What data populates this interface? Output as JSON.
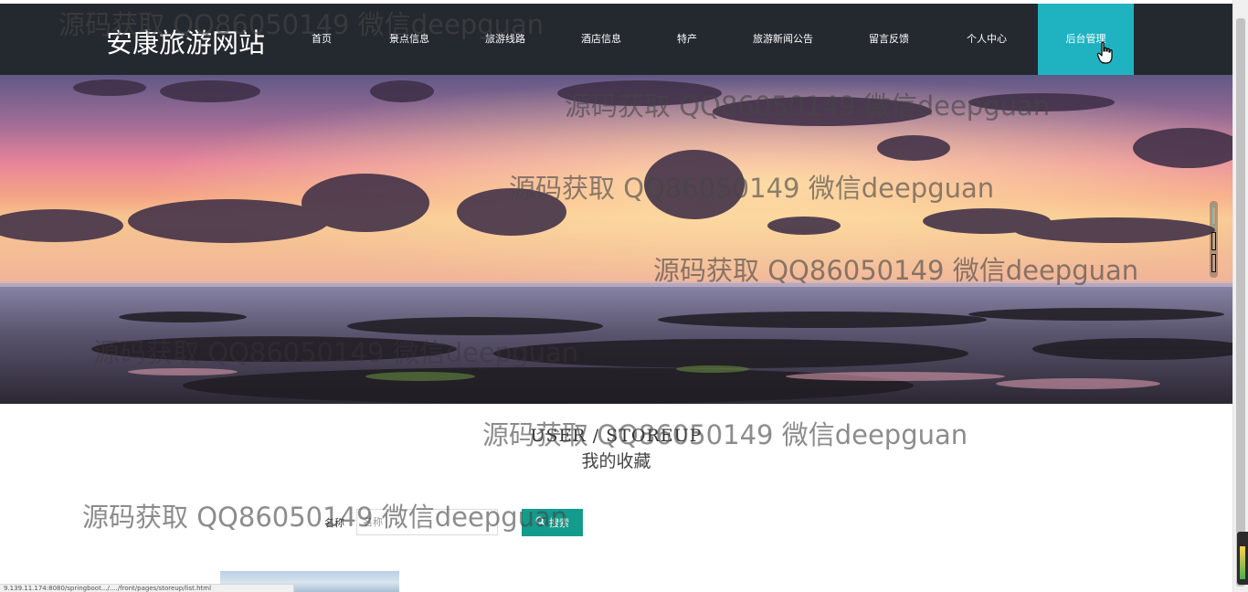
{
  "site": {
    "logo": "安康旅游网站"
  },
  "nav": {
    "items": [
      {
        "label": "首页",
        "active": false
      },
      {
        "label": "景点信息",
        "active": false
      },
      {
        "label": "旅游线路",
        "active": false
      },
      {
        "label": "酒店信息",
        "active": false
      },
      {
        "label": "特产",
        "active": false
      },
      {
        "label": "旅游新闻公告",
        "active": false
      },
      {
        "label": "留言反馈",
        "active": false
      },
      {
        "label": "个人中心",
        "active": false
      },
      {
        "label": "后台管理",
        "active": true
      }
    ]
  },
  "section": {
    "title_en": "USER / STOREUP",
    "title_cn": "我的收藏"
  },
  "search": {
    "label": "名称",
    "placeholder": "名称",
    "button_label": "搜索",
    "button_icon": "search-icon"
  },
  "status_bar": {
    "url": "9.139.11.174:8080/springboot.../..../front/pages/storeup/list.html"
  },
  "watermark": {
    "text": "源码获取 QQ86050149 微信deepguan"
  },
  "colors": {
    "header_bg": "#24282f",
    "nav_active": "#1fb3c1",
    "search_button": "#139c8c"
  }
}
